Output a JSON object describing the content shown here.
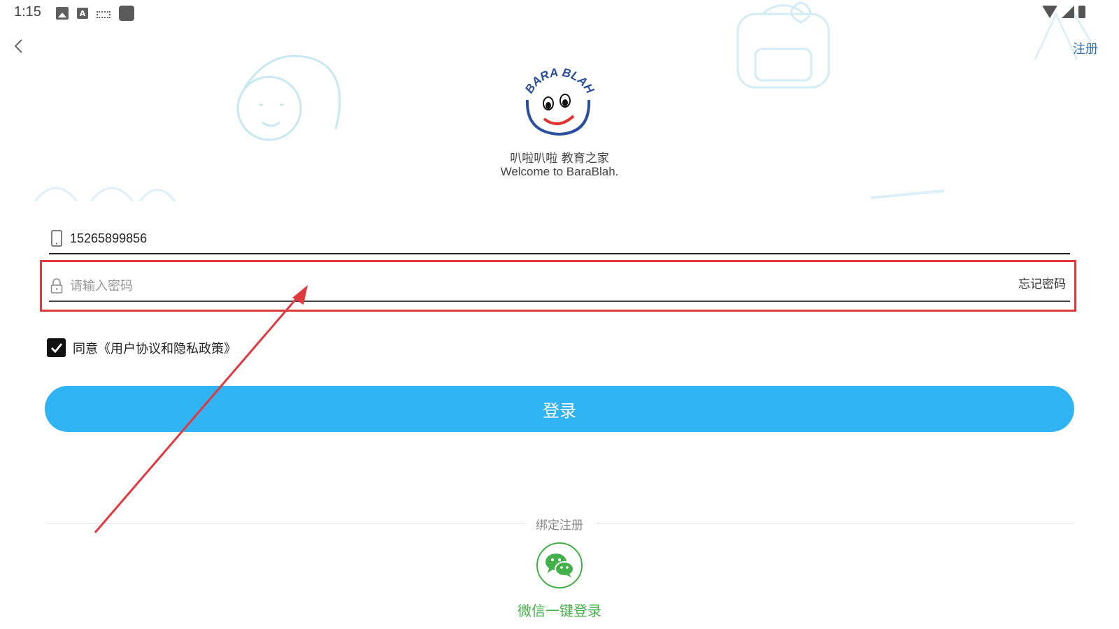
{
  "status_bar": {
    "time": "1:15"
  },
  "header": {
    "register_label": "注册"
  },
  "brand": {
    "logo_text": "BARA BLAH",
    "app_name": "叭啦叭啦 教育之家",
    "welcome": "Welcome to BaraBlah."
  },
  "form": {
    "phone_value": "15265899856",
    "password_placeholder": "请输入密码",
    "forgot_label": "忘记密码",
    "agreement_label": "同意《用户协议和隐私政策》",
    "agreement_checked": true,
    "login_label": "登录"
  },
  "social": {
    "divider_label": "绑定注册",
    "wechat_label": "微信一键登录"
  },
  "colors": {
    "accent": "#2fb3f3",
    "wechat": "#43b149",
    "annotation": "#e0393e",
    "link": "#2a6fb0"
  }
}
